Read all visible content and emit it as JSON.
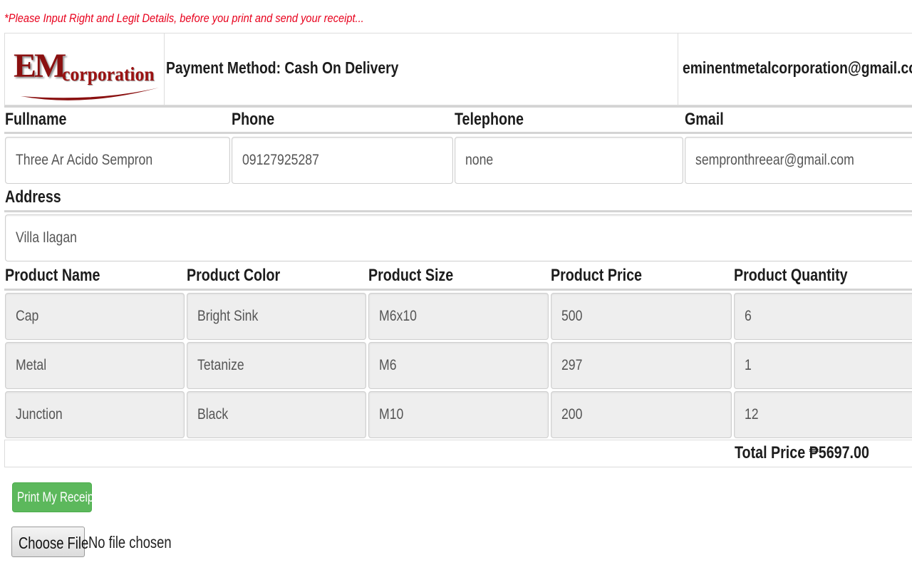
{
  "notice": "*Please Input Right and Legit Details, before you print and send your receipt...",
  "header": {
    "logo": {
      "em": "EM",
      "corp": "corporation"
    },
    "payment_method": "Payment Method: Cash On Delivery",
    "email": "eminentmetalcorporation@gmail.com"
  },
  "customer": {
    "labels": {
      "fullname": "Fullname",
      "phone": "Phone",
      "telephone": "Telephone",
      "gmail": "Gmail",
      "address": "Address"
    },
    "values": {
      "fullname": "Three Ar Acido Sempron",
      "phone": "09127925287",
      "telephone": "none",
      "gmail": "sempronthreear@gmail.com",
      "address": "Villa Ilagan"
    }
  },
  "products": {
    "headers": [
      "Product Name",
      "Product Color",
      "Product Size",
      "Product Price",
      "Product Quantity"
    ],
    "rows": [
      [
        "Cap",
        "Bright Sink",
        "M6x10",
        "500",
        "6"
      ],
      [
        "Metal",
        "Tetanize",
        "M6",
        "297",
        "1"
      ],
      [
        "Junction",
        "Black",
        "M10",
        "200",
        "12"
      ]
    ]
  },
  "total": "Total Price ₱5697.00",
  "actions": {
    "print_label": "Print My Receipt",
    "choose_file_label": "Choose File",
    "file_status": "No file chosen"
  },
  "colors": {
    "notice": "#e8001c",
    "print_button": "#5cb85c",
    "logo": "#8a1010"
  }
}
